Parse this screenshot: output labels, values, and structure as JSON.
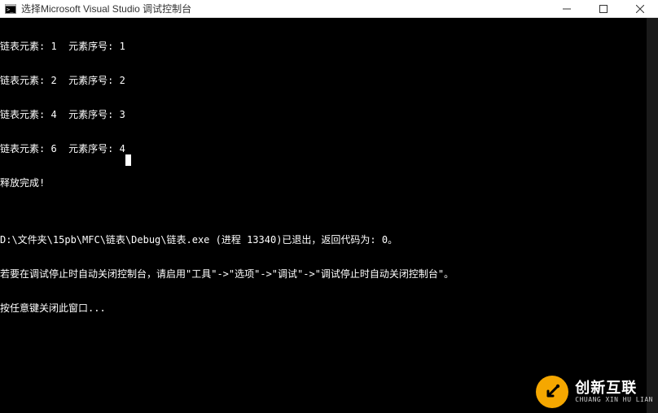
{
  "window": {
    "title": "选择Microsoft Visual Studio 调试控制台"
  },
  "console": {
    "lines": [
      "链表元素: 1  元素序号: 1",
      "链表元素: 2  元素序号: 2",
      "链表元素: 4  元素序号: 3",
      "链表元素: 6  元素序号: 4",
      "释放完成!",
      "",
      "D:\\文件夹\\15pb\\MFC\\链表\\Debug\\链表.exe (进程 13340)已退出，返回代码为: 0。",
      "若要在调试停止时自动关闭控制台，请启用\"工具\"->\"选项\"->\"调试\"->\"调试停止时自动关闭控制台\"。",
      "按任意键关闭此窗口..."
    ]
  },
  "watermark": {
    "cn": "创新互联",
    "en": "CHUANG XIN HU LIAN"
  },
  "icons": {
    "app": "console-app-icon",
    "minimize": "minimize-icon",
    "maximize": "maximize-icon",
    "close": "close-icon"
  }
}
